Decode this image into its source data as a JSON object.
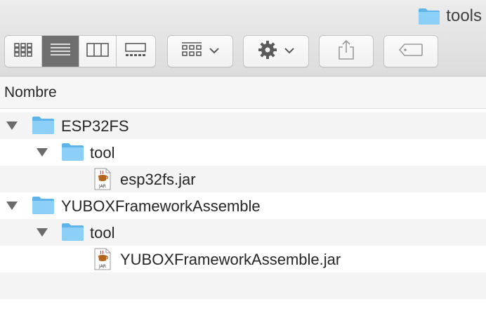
{
  "window": {
    "title": "tools",
    "title_icon": "folder-icon"
  },
  "toolbar": {
    "view_buttons": [
      {
        "name": "icon-view",
        "icon": "grid-icon",
        "active": false
      },
      {
        "name": "list-view",
        "icon": "list-icon",
        "active": true
      },
      {
        "name": "column-view",
        "icon": "columns-icon",
        "active": false
      },
      {
        "name": "gallery-view",
        "icon": "gallery-icon",
        "active": false
      }
    ],
    "arrange_icon": "arrange-grid-icon",
    "action_icon": "gear-icon",
    "share_icon": "share-icon",
    "tag_icon": "tag-icon"
  },
  "columns": {
    "name_header": "Nombre"
  },
  "items": [
    {
      "label": "ESP32FS",
      "type": "folder",
      "level": 0,
      "expanded": true
    },
    {
      "label": "tool",
      "type": "folder",
      "level": 1,
      "expanded": true
    },
    {
      "label": "esp32fs.jar",
      "type": "jar",
      "level": 2
    },
    {
      "label": "YUBOXFrameworkAssemble",
      "type": "folder",
      "level": 0,
      "expanded": true
    },
    {
      "label": "tool",
      "type": "folder",
      "level": 1,
      "expanded": true
    },
    {
      "label": "YUBOXFrameworkAssemble.jar",
      "type": "jar",
      "level": 2
    }
  ],
  "colors": {
    "folder": "#7cc7f5",
    "folder_tab": "#5eb4ea",
    "active_view": "#6e6e6e",
    "row_stripe": "#f4f4f4"
  }
}
